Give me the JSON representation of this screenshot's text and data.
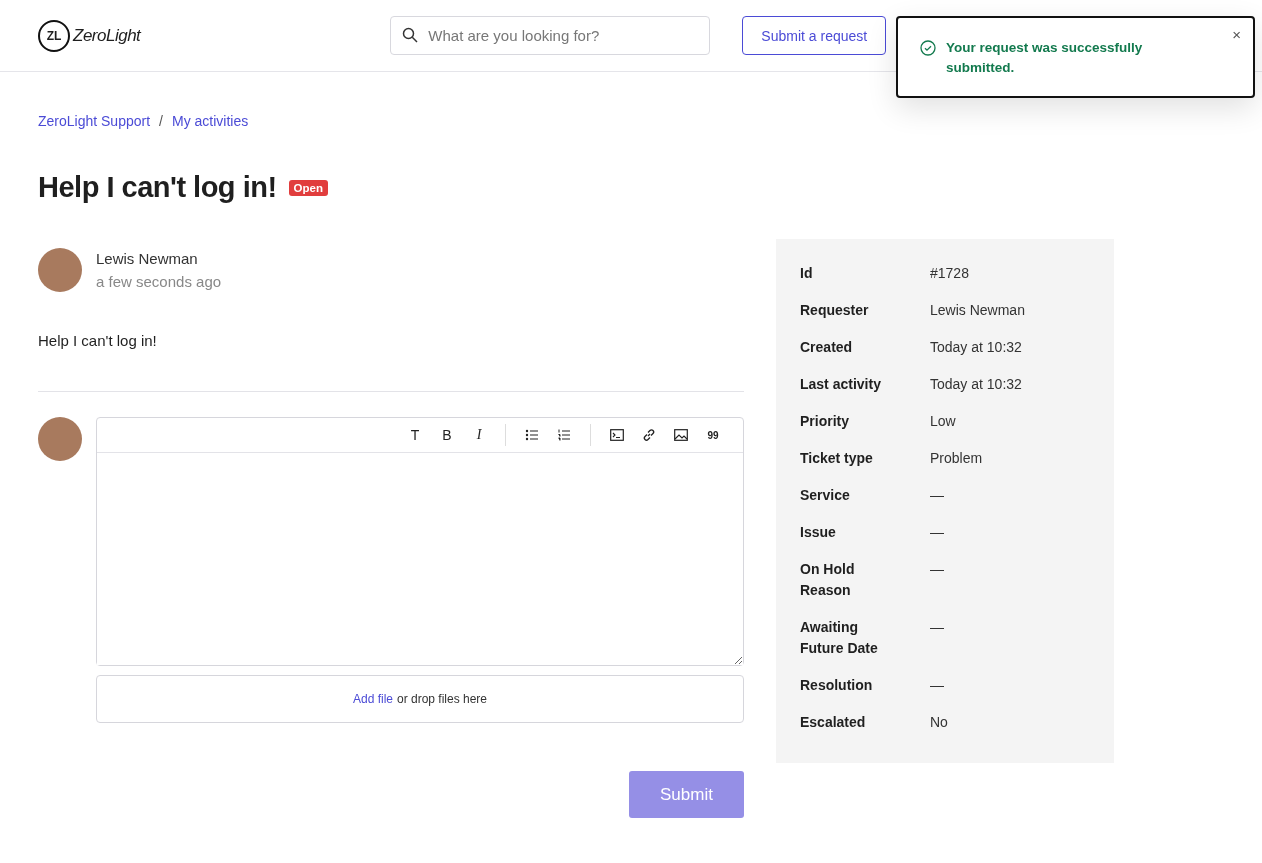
{
  "header": {
    "logo": {
      "mark": "ZL",
      "name": "ZeroLight"
    },
    "search": {
      "placeholder": "What are you looking for?"
    },
    "submit_request": "Submit a request"
  },
  "toast": {
    "message": "Your request was successfully submitted.",
    "close": "×"
  },
  "breadcrumbs": [
    "ZeroLight Support",
    "My activities"
  ],
  "breadcrumb_separator": "/",
  "ticket": {
    "title": "Help I can't log in!",
    "status": "Open"
  },
  "post": {
    "author": "Lewis Newman",
    "time": "a few seconds ago",
    "body": "Help I can't log in!"
  },
  "editor": {
    "toolbar": [
      {
        "kind": "text",
        "glyph": "T",
        "italic": false,
        "bold": false
      },
      {
        "kind": "text",
        "glyph": "B",
        "italic": false,
        "bold": false
      },
      {
        "kind": "text",
        "glyph": "I",
        "italic": true,
        "bold": false
      },
      {
        "kind": "divider"
      },
      {
        "kind": "bullets"
      },
      {
        "kind": "numbers"
      },
      {
        "kind": "divider"
      },
      {
        "kind": "code"
      },
      {
        "kind": "link"
      },
      {
        "kind": "image"
      },
      {
        "kind": "quote",
        "glyph": "99"
      }
    ],
    "add_file": "Add file",
    "drop_text": "or drop files here",
    "submit": {
      "label": "Submit",
      "disabled": true
    }
  },
  "details": [
    {
      "label": "Id",
      "value": "#1728"
    },
    {
      "label": "Requester",
      "value": "Lewis Newman"
    },
    {
      "label": "Created",
      "value": "Today at 10:32"
    },
    {
      "label": "Last activity",
      "value": "Today at 10:32"
    },
    {
      "label": "Priority",
      "value": "Low"
    },
    {
      "label": "Ticket type",
      "value": "Problem"
    },
    {
      "label": "Service",
      "value": "—"
    },
    {
      "label": "Issue",
      "value": "—"
    },
    {
      "label": "On Hold Reason",
      "value": "—"
    },
    {
      "label": "Awaiting Future Date",
      "value": "—"
    },
    {
      "label": "Resolution",
      "value": "—"
    },
    {
      "label": "Escalated",
      "value": "No"
    }
  ]
}
